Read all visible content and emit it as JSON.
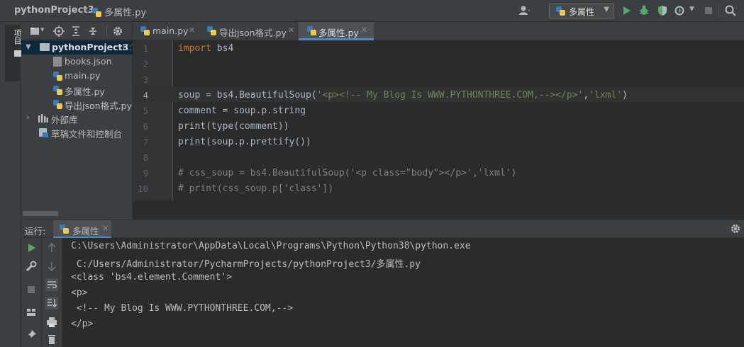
{
  "breadcrumb": {
    "project": "pythonProject3",
    "file": "多属性.py"
  },
  "toolbar": {
    "run_config": "多属性"
  },
  "left_strip": {
    "project_label": "项目"
  },
  "project_panel": {
    "tree": [
      {
        "label": "pythonProject3",
        "suffix": "C:\\",
        "type": "folder"
      },
      {
        "label": "books.json",
        "type": "json"
      },
      {
        "label": "main.py",
        "type": "py"
      },
      {
        "label": "多属性.py",
        "type": "py"
      },
      {
        "label": "导出json格式.py",
        "type": "py"
      },
      {
        "label": "外部库",
        "type": "lib"
      },
      {
        "label": "草稿文件和控制台",
        "type": "scratch"
      }
    ]
  },
  "editor": {
    "tabs": [
      {
        "label": "main.py"
      },
      {
        "label": "导出json格式.py"
      },
      {
        "label": "多属性.py"
      }
    ],
    "line_numbers": [
      "1",
      "2",
      "3",
      "4",
      "5",
      "6",
      "7",
      "8",
      "9",
      "10"
    ],
    "code": {
      "l1_kw": "import",
      "l1_rest": " bs4",
      "l4_a": "soup = bs4.BeautifulSoup(",
      "l4_s1": "'<p><!-- My Blog Is WWW.PYTHONTHREE.COM,--></p>'",
      "l4_b": ",",
      "l4_s2": "'lxml'",
      "l4_c": ")",
      "l5": "comment = soup.p.string",
      "l6": "print(type(comment))",
      "l7": "print(soup.p.prettify())",
      "l9": "# css_soup = bs4.BeautifulSoup('<p class=\"body\"></p>','lxml')",
      "l10": "# print(css_soup.p['class'])"
    }
  },
  "run_panel": {
    "label": "运行:",
    "tab": "多属性",
    "console": [
      "C:\\Users\\Administrator\\AppData\\Local\\Programs\\Python\\Python38\\python.exe",
      " C:/Users/Administrator/PycharmProjects/pythonProject3/多属性.py",
      "<class 'bs4.element.Comment'>",
      "<p>",
      " <!-- My Blog Is WWW.PYTHONTHREE.COM,-->",
      "</p>"
    ]
  },
  "colors": {
    "accent": "#4a88c7",
    "keyword": "#cc7832",
    "string": "#6a8759",
    "comment": "#808080",
    "run_green": "#59a869"
  }
}
